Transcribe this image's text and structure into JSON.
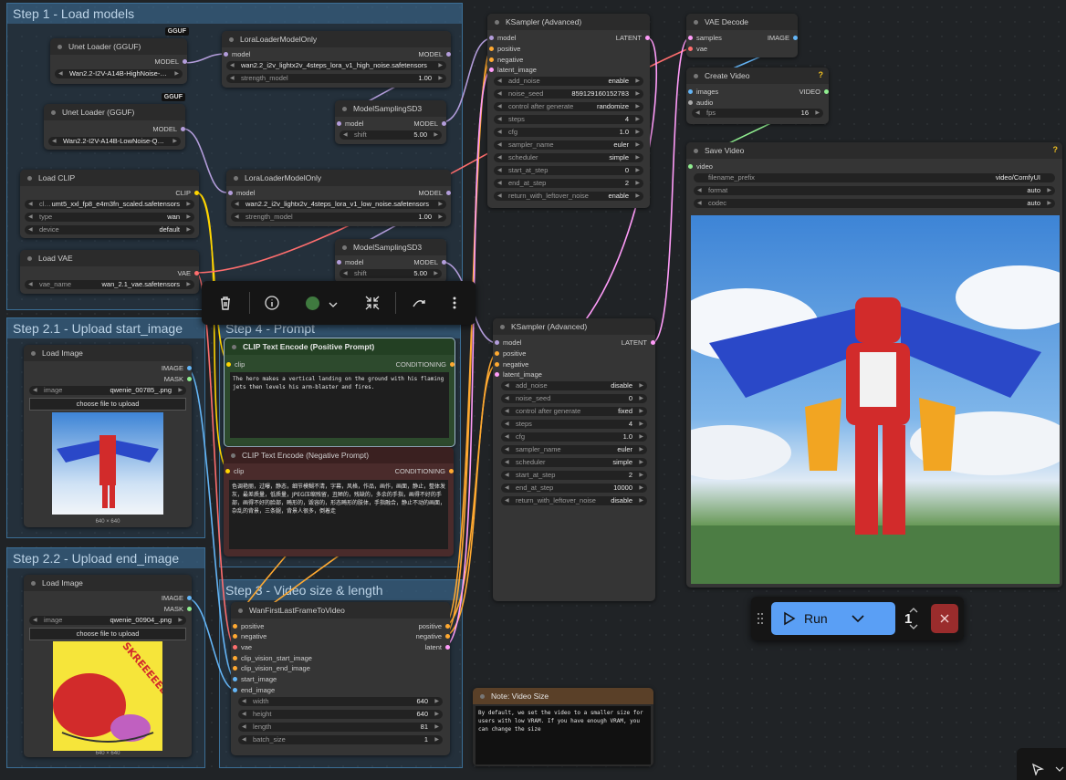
{
  "colors": {
    "model": "#b39ddb",
    "clip": "#ffd500",
    "vae": "#ff6e6e",
    "latent": "#ff9cf9",
    "conditioning": "#ffa931",
    "image": "#64b5f6",
    "video": "#90ee90",
    "audio": "#aaaaaa"
  },
  "groups": {
    "load_models": "Step 1 - Load models",
    "upload_start": "Step 2.1 - Upload start_image",
    "upload_end": "Step 2.2 - Upload end_image",
    "prompt": "Step 4 - Prompt",
    "video_size": "Step 3 - Video size & length"
  },
  "unet_high": {
    "title": "Unet Loader (GGUF)",
    "badge": "GGUF",
    "out": "MODEL",
    "value": "Wan2.2-I2V-A14B-HighNoise-…"
  },
  "unet_low": {
    "title": "Unet Loader (GGUF)",
    "badge": "GGUF",
    "out": "MODEL",
    "value": "Wan2.2-I2V-A14B-LowNoise-Q…"
  },
  "load_clip": {
    "title": "Load CLIP",
    "out": "CLIP",
    "clip_name_label": "cl…",
    "clip_name": "umt5_xxl_fp8_e4m3fn_scaled.safetensors",
    "type_label": "type",
    "type": "wan",
    "device_label": "device",
    "device": "default"
  },
  "load_vae": {
    "title": "Load VAE",
    "out": "VAE",
    "name_label": "vae_name",
    "name": "wan_2.1_vae.safetensors"
  },
  "lora_high": {
    "title": "LoraLoaderModelOnly",
    "in": "model",
    "out": "MODEL",
    "lora": "wan2.2_i2v_lightx2v_4steps_lora_v1_high_noise.safetensors",
    "strength_label": "strength_model",
    "strength": "1.00"
  },
  "lora_low": {
    "title": "LoraLoaderModelOnly",
    "in": "model",
    "out": "MODEL",
    "lora": "wan2.2_i2v_lightx2v_4steps_lora_v1_low_noise.safetensors",
    "strength_label": "strength_model",
    "strength": "1.00"
  },
  "ms_high": {
    "title": "ModelSamplingSD3",
    "in": "model",
    "out": "MODEL",
    "shift_label": "shift",
    "shift": "5.00"
  },
  "ms_low": {
    "title": "ModelSamplingSD3",
    "in": "model",
    "out": "MODEL",
    "shift_label": "shift",
    "shift": "5.00"
  },
  "ks1": {
    "title": "KSampler (Advanced)",
    "inputs": [
      "model",
      "positive",
      "negative",
      "latent_image"
    ],
    "out": "LATENT",
    "widgets": [
      [
        "add_noise",
        "enable"
      ],
      [
        "noise_seed",
        "859129160152783"
      ],
      [
        "control after generate",
        "randomize"
      ],
      [
        "steps",
        "4"
      ],
      [
        "cfg",
        "1.0"
      ],
      [
        "sampler_name",
        "euler"
      ],
      [
        "scheduler",
        "simple"
      ],
      [
        "start_at_step",
        "0"
      ],
      [
        "end_at_step",
        "2"
      ],
      [
        "return_with_leftover_noise",
        "enable"
      ]
    ]
  },
  "ks2": {
    "title": "KSampler (Advanced)",
    "inputs": [
      "model",
      "positive",
      "negative",
      "latent_image"
    ],
    "out": "LATENT",
    "widgets": [
      [
        "add_noise",
        "disable"
      ],
      [
        "noise_seed",
        "0"
      ],
      [
        "control after generate",
        "fixed"
      ],
      [
        "steps",
        "4"
      ],
      [
        "cfg",
        "1.0"
      ],
      [
        "sampler_name",
        "euler"
      ],
      [
        "scheduler",
        "simple"
      ],
      [
        "start_at_step",
        "2"
      ],
      [
        "end_at_step",
        "10000"
      ],
      [
        "return_with_leftover_noise",
        "disable"
      ]
    ]
  },
  "vae_decode": {
    "title": "VAE Decode",
    "in1": "samples",
    "in2": "vae",
    "out": "IMAGE"
  },
  "create_video": {
    "title": "Create Video",
    "in1": "images",
    "in2": "audio",
    "out": "VIDEO",
    "fps_label": "fps",
    "fps": "16",
    "warn": "?"
  },
  "save_video": {
    "title": "Save Video",
    "in": "video",
    "warn": "?",
    "prefix_label": "filename_prefix",
    "prefix": "video/ComfyUI",
    "format_label": "format",
    "format": "auto",
    "codec_label": "codec",
    "codec": "auto"
  },
  "load_image1": {
    "title": "Load Image",
    "out1": "IMAGE",
    "out2": "MASK",
    "image_label": "image",
    "image": "qwenie_00785_.png",
    "upload": "choose file to upload",
    "caption": "640 × 640"
  },
  "load_image2": {
    "title": "Load Image",
    "out1": "IMAGE",
    "out2": "MASK",
    "image_label": "image",
    "image": "qwenie_00904_.png",
    "upload": "choose file to upload",
    "caption": "640 × 640",
    "comic_text": "SKREEEEEE!"
  },
  "pos_prompt": {
    "title": "CLIP Text Encode (Positive Prompt)",
    "in": "clip",
    "out": "CONDITIONING",
    "text": "The hero makes a vertical landing on the ground with his flaming jets then levels his arm-blaster and fires."
  },
  "neg_prompt": {
    "title": "CLIP Text Encode (Negative Prompt)",
    "in": "clip",
    "out": "CONDITIONING",
    "text": "色调艳丽，过曝，静态，细节模糊不清，字幕，风格，作品，画作，画面，静止，整体发灰，最差质量，低质量，JPEG压缩残留，丑陋的，残缺的，多余的手指，画得不好的手部，画得不好的脸部，畸形的，毁容的，形态畸形的肢体，手指融合，静止不动的画面，杂乱的背景，三条腿，背景人很多，倒着走"
  },
  "wan_flf": {
    "title": "WanFirstLastFrameToVideo",
    "inputs": [
      "positive",
      "negative",
      "vae",
      "clip_vision_start_image",
      "clip_vision_end_image",
      "start_image",
      "end_image"
    ],
    "outs": [
      "positive",
      "negative",
      "latent"
    ],
    "widgets": [
      [
        "width",
        "640"
      ],
      [
        "height",
        "640"
      ],
      [
        "length",
        "81"
      ],
      [
        "batch_size",
        "1"
      ]
    ]
  },
  "note": {
    "title": "Note: Video Size",
    "text": "By default, we set the video to a smaller size for users with low VRAM. If you have enough VRAM, you can change the size"
  },
  "toolbar": {
    "delete": "delete-icon",
    "info": "info-icon",
    "color": "color-icon",
    "collapse": "collapse-icon",
    "bypass": "bypass-icon",
    "more": "more-icon"
  },
  "run": {
    "label": "Run",
    "count": "1"
  }
}
